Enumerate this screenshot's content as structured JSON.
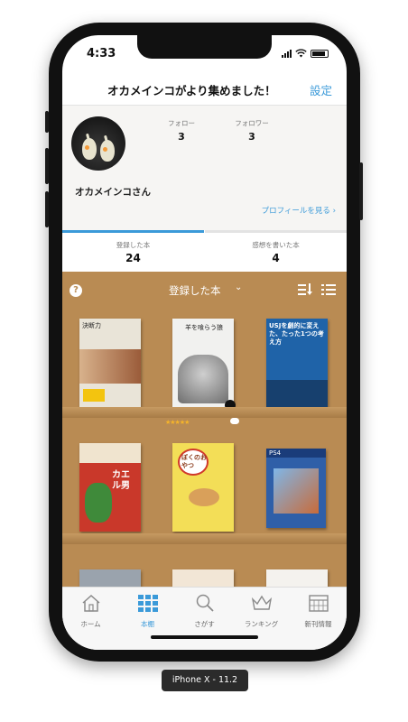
{
  "status_bar": {
    "time": "4:33"
  },
  "nav": {
    "title": "オカメインコがより集めました！",
    "settings_label": "設定"
  },
  "profile": {
    "follow_label": "フォロー",
    "follow_count": "3",
    "follower_label": "フォロワー",
    "follower_count": "3",
    "username": "オカメインコさん",
    "view_profile_link": "プロフィールを見る ›"
  },
  "segments": [
    {
      "label": "登録した本",
      "count": "24",
      "selected": true
    },
    {
      "label": "感想を書いた本",
      "count": "4",
      "selected": false
    }
  ],
  "shelf": {
    "help_label": "?",
    "title": "登録した本",
    "chevron": "⌄",
    "books": [
      {
        "title": "決断力",
        "color": "#e9e4d8",
        "text_color": "#222"
      },
      {
        "title": "羊を喰らう狼",
        "color": "#f1f1ef",
        "text_color": "#222"
      },
      {
        "title": "USJを劇的に変えた、たった1つの考え方",
        "color": "#1f63a8",
        "text_color": "#ffffff"
      },
      {
        "title": "カエル男",
        "color": "#c9382a",
        "text_color": "#ffffff"
      },
      {
        "title": "ぼくのおやつ",
        "color": "#f3de57",
        "text_color": "#8a3a1a"
      },
      {
        "title": "PS4",
        "color": "#2f5fa8",
        "text_color": "#ffffff"
      }
    ],
    "rating_stars": "★★★★★"
  },
  "tabbar": {
    "tabs": [
      {
        "label": "ホーム",
        "icon": "house-icon",
        "active": false
      },
      {
        "label": "本棚",
        "icon": "bookshelf-grid-icon",
        "active": true
      },
      {
        "label": "さがす",
        "icon": "search-icon",
        "active": false
      },
      {
        "label": "ランキング",
        "icon": "crown-icon",
        "active": false
      },
      {
        "label": "新刊情報",
        "icon": "calendar-icon",
        "active": false
      }
    ]
  },
  "device_caption": "iPhone X - 11.2",
  "colors": {
    "accent": "#3b9ad9",
    "shelf": "#b98b53",
    "profile_bg": "#f6f5f3",
    "tab_active": "#3b9ad9",
    "tab_inactive": "#8a8a8a"
  }
}
